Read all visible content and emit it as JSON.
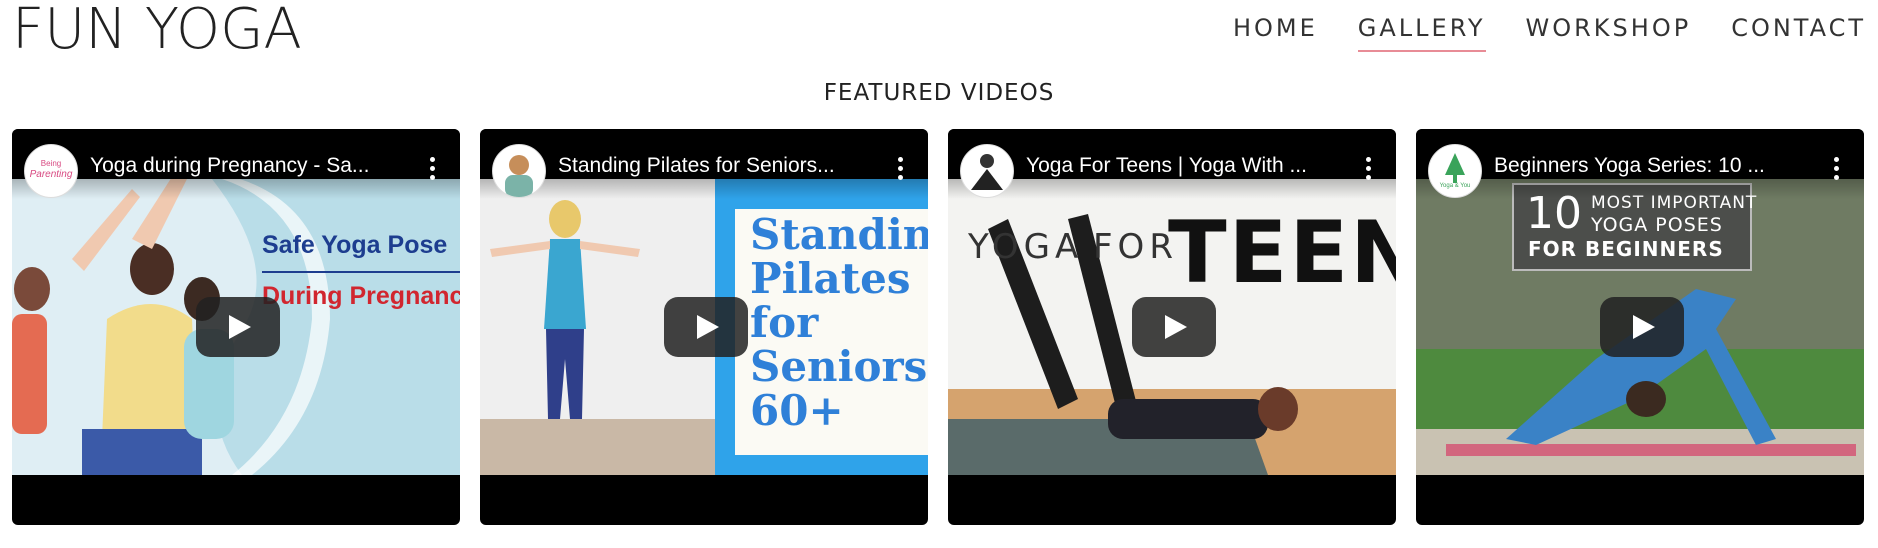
{
  "site": {
    "logo": "FUN YOGA"
  },
  "nav": [
    {
      "label": "HOME"
    },
    {
      "label": "GALLERY"
    },
    {
      "label": "WORKSHOP"
    },
    {
      "label": "CONTACT"
    }
  ],
  "section": {
    "title": "FEATURED VIDEOS"
  },
  "videos": [
    {
      "title": "Yoga during Pregnancy - Sa...",
      "avatar_text_1": "Being",
      "avatar_text_2": "Parenting",
      "thumb_text_1": "Safe Yoga Pose",
      "thumb_text_2": "During Pregnanc"
    },
    {
      "title": "Standing Pilates for Seniors...",
      "thumb_lines": [
        "Standing",
        "Pilates",
        "for",
        "Seniors",
        "60+"
      ]
    },
    {
      "title": "Yoga For Teens | Yoga With ...",
      "thumb_text_1": "YOGA",
      "thumb_text_2": "FOR",
      "thumb_text_3": "TEENS"
    },
    {
      "title": "Beginners Yoga Series: 10 ...",
      "avatar_text": "Yoga & You",
      "thumb_num": "10",
      "thumb_text_1": "MOST IMPORTANT",
      "thumb_text_2": "YOGA POSES",
      "thumb_text_3": "FOR BEGINNERS"
    }
  ],
  "colors": {
    "nav_active_underline": "#e88c96",
    "video_bg": "#000000",
    "pilates_blue": "#2f80d8",
    "pregnancy_blue": "#1d3d8f",
    "pregnancy_red": "#d1262f"
  }
}
